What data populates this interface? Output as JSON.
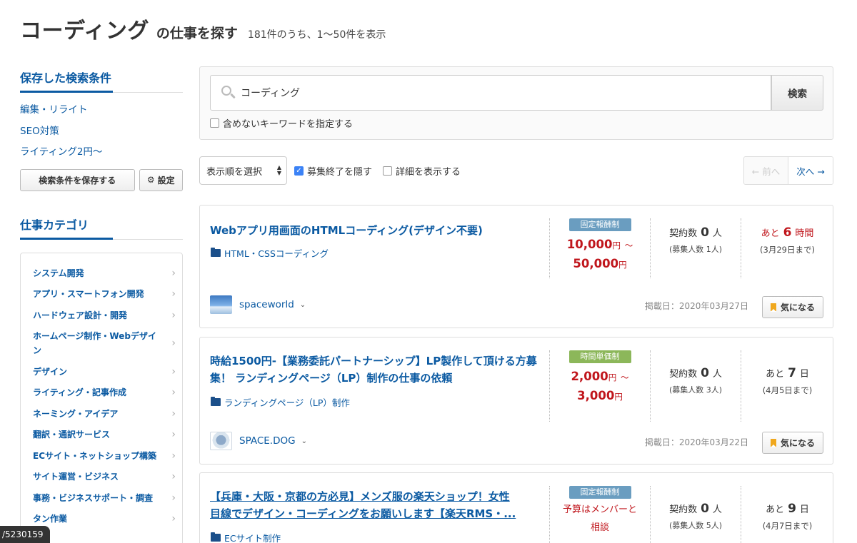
{
  "header": {
    "keyword": "コーディング",
    "suffix": "の仕事を探す",
    "count": "181件のうち、1〜50件を表示"
  },
  "sidebar": {
    "saved_heading": "保存した検索条件",
    "saved_items": [
      "編集・リライト",
      "SEO対策",
      "ライティング2円〜"
    ],
    "save_button": "検索条件を保存する",
    "settings_button": "設定",
    "category_heading": "仕事カテゴリ",
    "categories": [
      "システム開発",
      "アプリ・スマートフォン開発",
      "ハードウェア設計・開発",
      "ホームページ制作・Webデザイン",
      "デザイン",
      "ライティング・記事作成",
      "ネーミング・アイデア",
      "翻訳・通訳サービス",
      "ECサイト・ネットショップ構築",
      "サイト運営・ビジネス",
      "事務・ビジネスサポート・調査",
      "タン作業"
    ]
  },
  "search": {
    "value": "コーディング",
    "button": "検索",
    "exclude_label": "含めないキーワードを指定する"
  },
  "toolbar": {
    "sort_label": "表示順を選択",
    "hide_closed_label": "募集終了を隠す",
    "hide_closed_checked": true,
    "show_detail_label": "詳細を表示する",
    "prev_label": "← 前へ",
    "next_label": "次へ →"
  },
  "jobs": [
    {
      "title": "Webアプリ用画面のHTMLコーディング(デザイン不要)",
      "category": "HTML・CSSコーディング",
      "pay_type": "固定報酬制",
      "price_min": "10,000",
      "price_max": "50,000",
      "yen": "円",
      "tilde": "〜",
      "contracts_label": "契約数",
      "contracts": "0",
      "contracts_unit": "人",
      "recruit": "(募集人数 1人)",
      "remain_prefix": "あと",
      "remain_value": "6",
      "remain_unit": "時間",
      "deadline": "(3月29日まで)",
      "client": "spaceworld",
      "posted": "掲載日：2020年03月27日",
      "fav": "気になる"
    },
    {
      "title": "時給1500円-【業務委託パートナーシップ】LP製作して頂ける方募集！ ランディングページ（LP）制作の仕事の依頼",
      "category": "ランディングページ（LP）制作",
      "pay_type": "時間単価制",
      "price_min": "2,000",
      "price_max": "3,000",
      "yen": "円",
      "tilde": "〜",
      "contracts_label": "契約数",
      "contracts": "0",
      "contracts_unit": "人",
      "recruit": "(募集人数 3人)",
      "remain_prefix": "あと",
      "remain_value": "7",
      "remain_unit": "日",
      "deadline": "(4月5日まで)",
      "client": "SPACE.DOG",
      "posted": "掲載日：2020年03月22日",
      "fav": "気になる"
    },
    {
      "title_line1": "【兵庫・大阪・京都の方必見】メンズ服の楽天ショップ！女性",
      "title_line2": "目線でデザイン・コーディングをお願いします【楽天RMS・...",
      "category": "ECサイト制作",
      "pay_type": "固定報酬制",
      "price_text_1": "予算はメンバーと",
      "price_text_2": "相談",
      "contracts_label": "契約数",
      "contracts": "0",
      "contracts_unit": "人",
      "recruit": "(募集人数 5人)",
      "remain_prefix": "あと",
      "remain_value": "9",
      "remain_unit": "日",
      "deadline": "(4月7日まで)"
    }
  ],
  "overlay_id": "/5230159"
}
